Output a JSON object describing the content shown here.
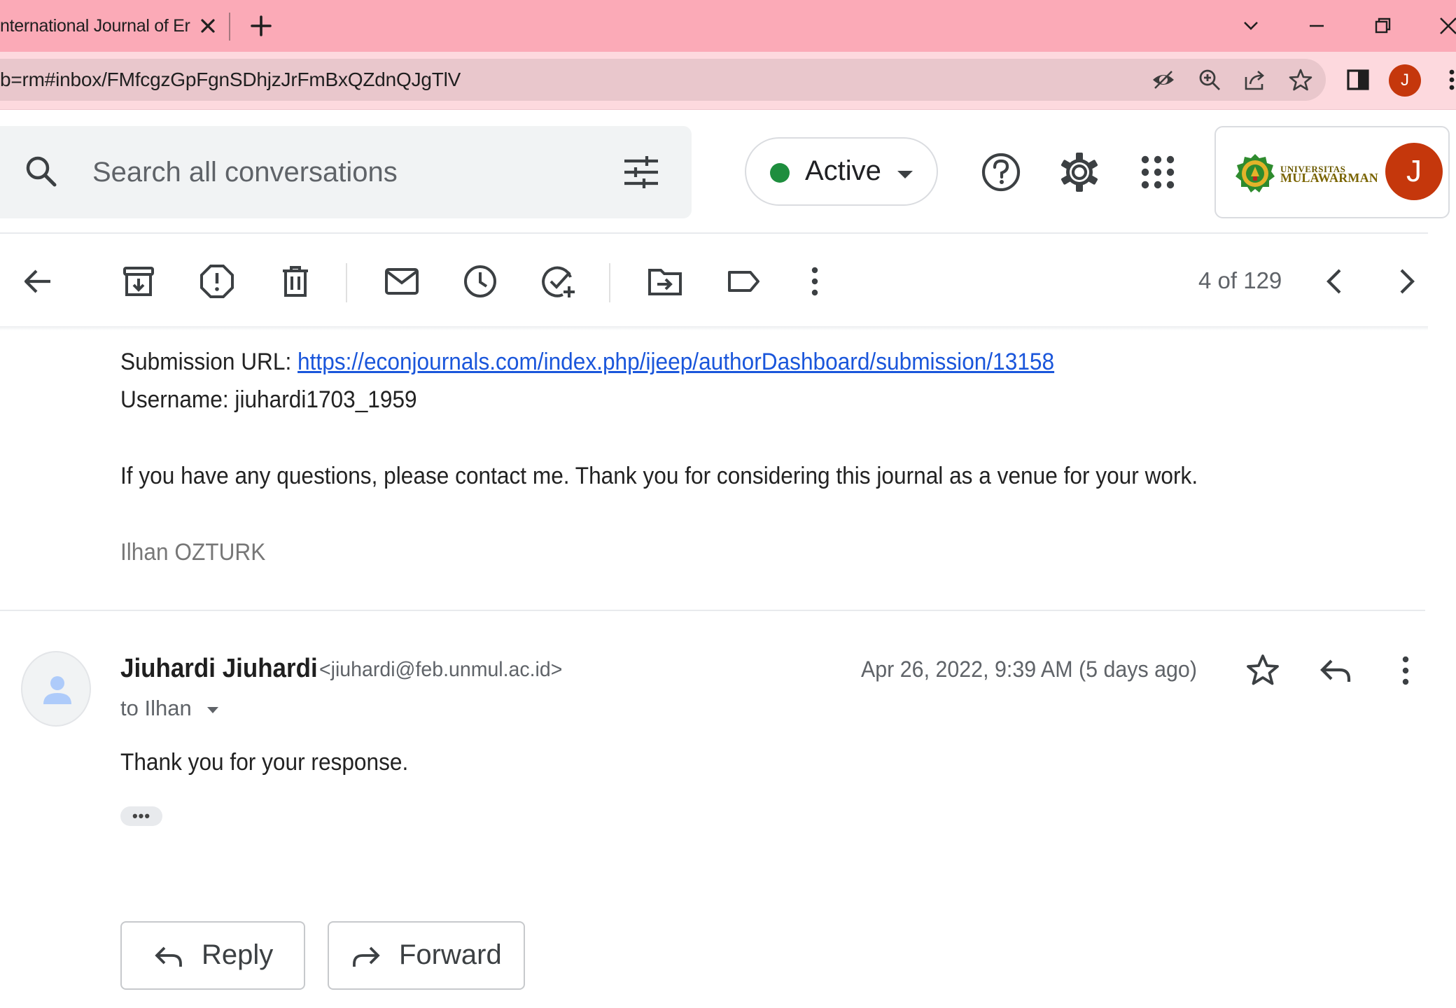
{
  "browser": {
    "tab_title": "nternational Journal of Er",
    "url": "b=rm#inbox/FMfcgzGpFgnSDhjzJrFmBxQZdnQJgTlV",
    "profile_initial": "J"
  },
  "header": {
    "search_placeholder": "Search all conversations",
    "status_label": "Active",
    "account_initial": "J",
    "org_logo_text_line1": "UNIVERSITAS",
    "org_logo_text_line2": "MULAWARMAN"
  },
  "toolbar": {
    "pager_text": "4 of 129"
  },
  "message1": {
    "submission_label": "Submission URL: ",
    "submission_url": "https://econjournals.com/index.php/ijeep/authorDashboard/submission/13158",
    "username_line": "Username: jiuhardi1703_1959",
    "closing_line": "If you have any questions, please contact me. Thank you for considering this journal as a venue for your work.",
    "signature": "Ilhan OZTURK"
  },
  "message2": {
    "sender_name": "Jiuhardi Jiuhardi",
    "sender_email": "<jiuhardi@feb.unmul.ac.id>",
    "recipient": "to Ilhan",
    "date": "Apr 26, 2022, 9:39 AM (5 days ago)",
    "body": "Thank you for your response.",
    "trimmed_indicator": "•••"
  },
  "actions": {
    "reply_label": "Reply",
    "forward_label": "Forward"
  },
  "colors": {
    "tabbar_bg": "#fbaab7",
    "addressbar_bg": "#fdd9de",
    "status_green": "#1e8e3e",
    "avatar_bg": "#c5370c",
    "link": "#1a56db"
  }
}
